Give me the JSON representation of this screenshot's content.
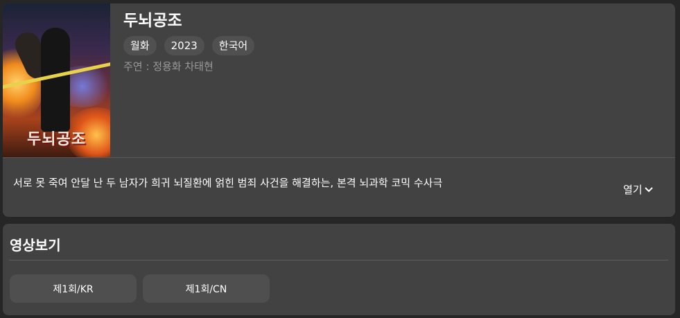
{
  "show": {
    "title": "두뇌공조",
    "tags": [
      "월화",
      "2023",
      "한국어"
    ],
    "cast_label": "주연 : ",
    "cast_names": "정용화 차태현",
    "description": "서로 못 죽여 안달 난 두 남자가 희귀 뇌질환에 얽힌 범죄 사건을 해결하는, 본격 뇌과학 코믹 수사극",
    "expand_label": "열기",
    "expand_icon": "chevron-down-icon",
    "poster": {
      "logo_text": "두뇌공조"
    }
  },
  "videos": {
    "section_title": "영상보기",
    "episodes": [
      {
        "label": "제1회/KR"
      },
      {
        "label": "제1회/CN"
      }
    ]
  },
  "colors": {
    "background": "#262626",
    "card": "#424242",
    "tag": "#505050",
    "button": "#4f4f4f",
    "muted_text": "#9a9a9a"
  }
}
